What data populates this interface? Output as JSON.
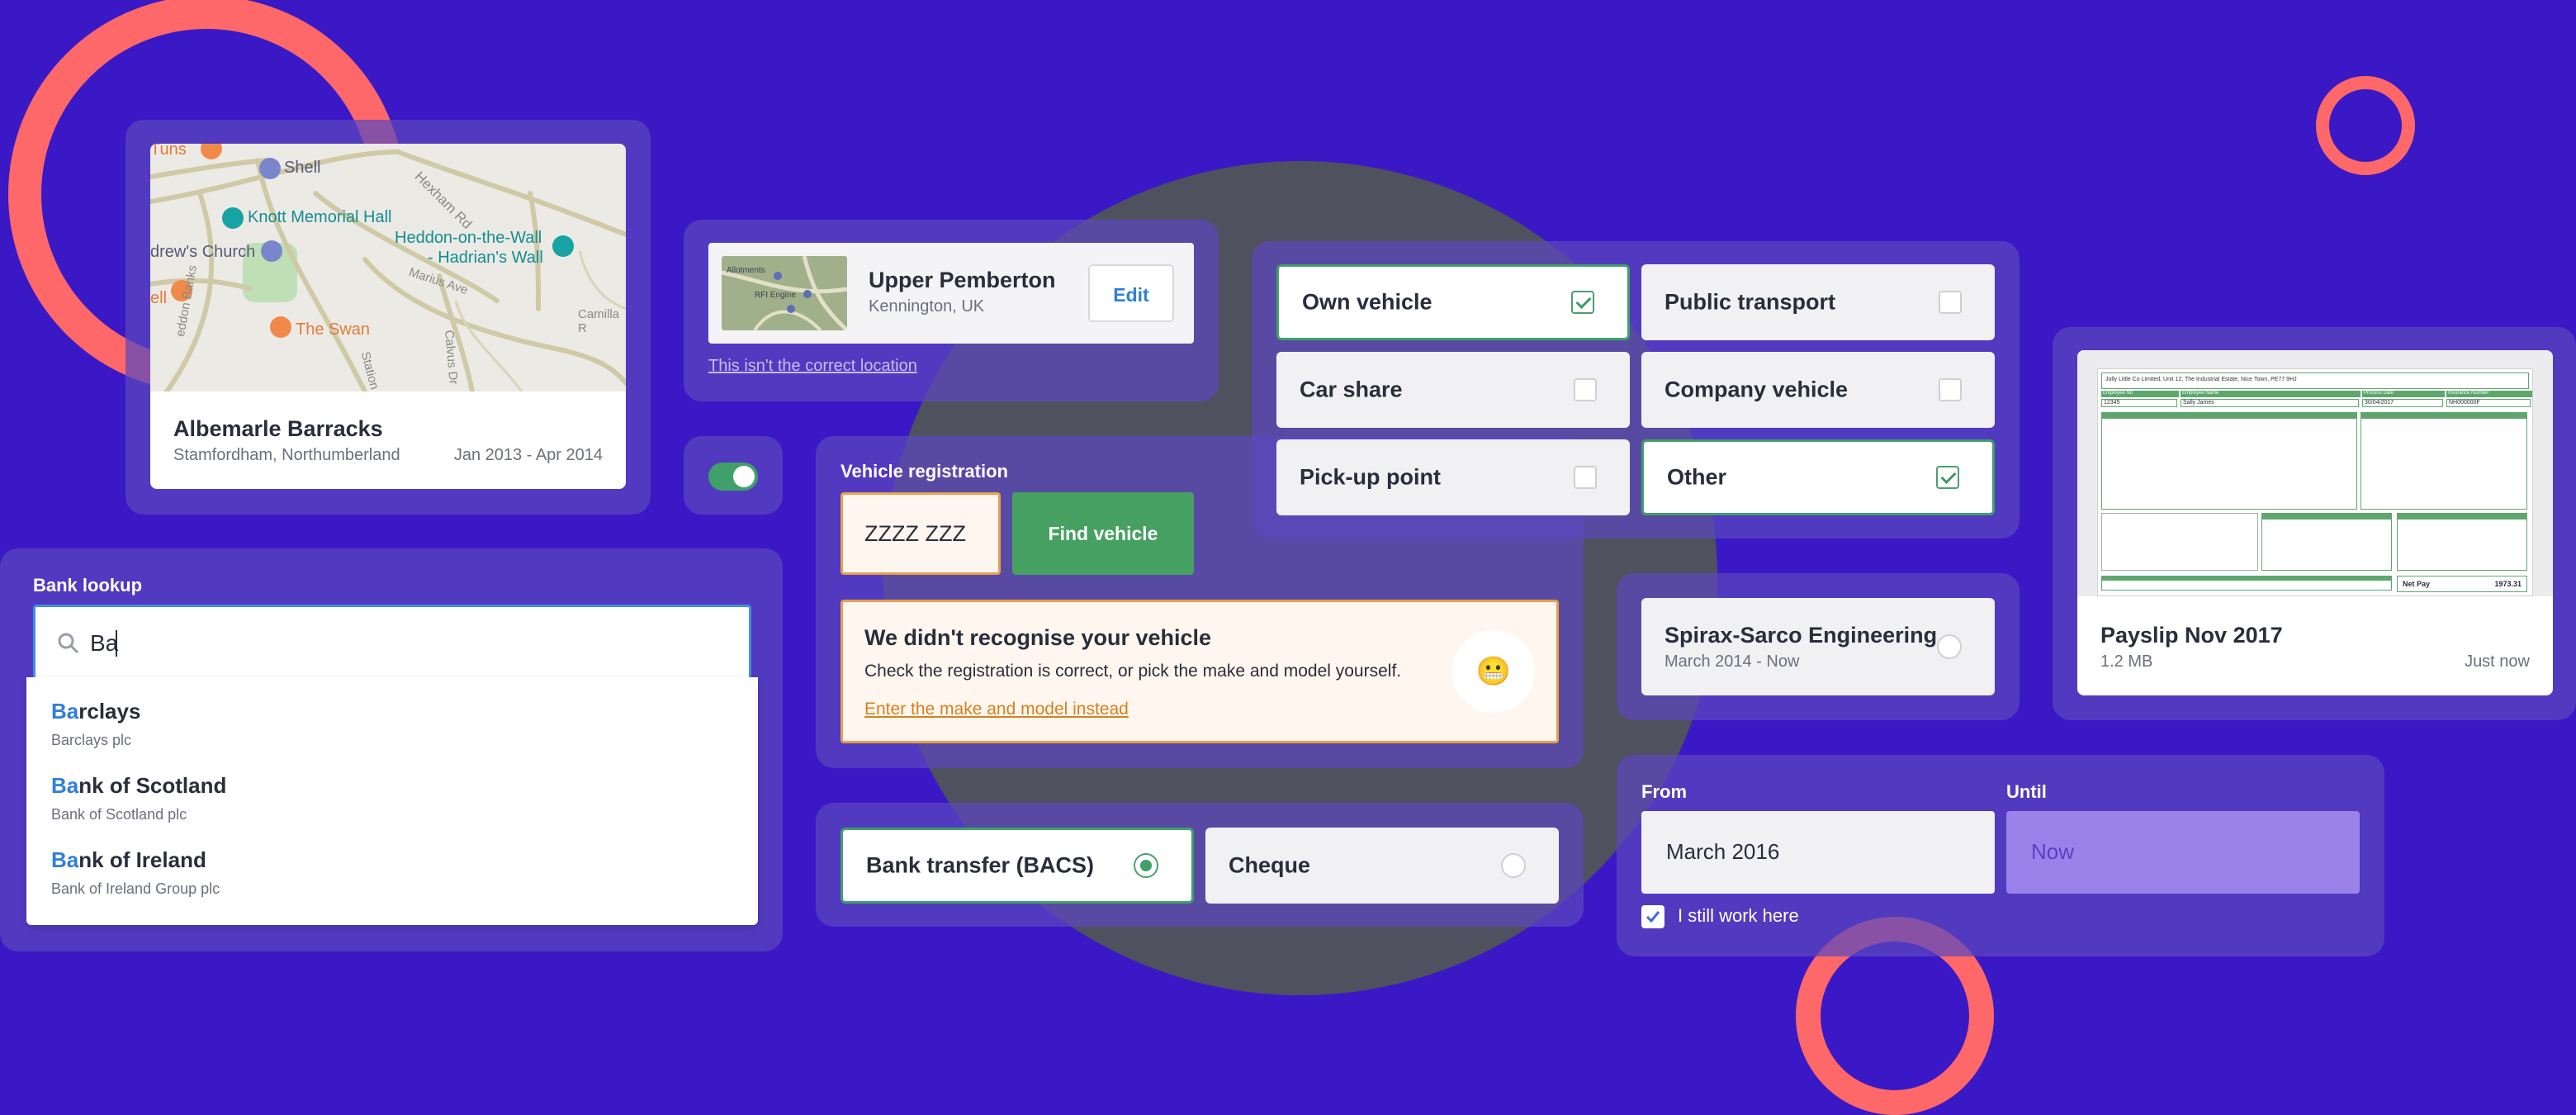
{
  "colors": {
    "background": "#3a18c6",
    "panel": "#5536cf",
    "accent_green": "#46a062",
    "ring_coral": "#ff6868",
    "link_blue": "#2f7fd8",
    "warning_orange": "#e8a04a"
  },
  "location_card": {
    "map": {
      "labels": [
        "Tuns",
        "Shell",
        "Knott Memorial Hall",
        "Hexham Rd",
        "Heddon-on-the-Wall",
        "- Hadrian's Wall",
        "drew's Church",
        "ell",
        "The Swan",
        "Marius Ave",
        "Camilla R",
        "Station",
        "Calvus Dr",
        "eddon Banks"
      ]
    },
    "title": "Albemarle Barracks",
    "subtitle": "Stamfordham, Northumberland",
    "dates": "Jan 2013 - Apr 2014"
  },
  "address_card": {
    "thumb_labels": [
      "Allotments",
      "RFI Engine"
    ],
    "title": "Upper Pemberton",
    "subtitle": "Kennington, UK",
    "edit_label": "Edit",
    "link": "This isn't the correct location"
  },
  "toggle": {
    "state": "on"
  },
  "vehicle": {
    "label": "Vehicle registration",
    "value": "ZZZZ ZZZ",
    "button": "Find vehicle",
    "warning_title": "We didn't recognise your vehicle",
    "warning_body": "Check the registration is correct, or pick the make and model yourself.",
    "warning_link": "Enter the make and model instead",
    "emoji": "😬"
  },
  "transport": {
    "options": [
      {
        "label": "Own vehicle",
        "checked": true
      },
      {
        "label": "Public transport",
        "checked": false
      },
      {
        "label": "Car share",
        "checked": false
      },
      {
        "label": "Company vehicle",
        "checked": false
      },
      {
        "label": "Pick-up point",
        "checked": false
      },
      {
        "label": "Other",
        "checked": true
      }
    ]
  },
  "payslip": {
    "doc": {
      "company": "Jolly Little Co Limited, Unit 12, The Industrial Estate, Nice Town, PE77 9HJ",
      "headers": [
        "Employee No",
        "Employee Name",
        "Process Date",
        "Insurance Number"
      ],
      "values": [
        "12345",
        "Sally James",
        "30/04/2017",
        "NH000000F"
      ],
      "net_pay_label": "Net Pay",
      "net_pay": "1973.31"
    },
    "title": "Payslip Nov 2017",
    "size": "1.2 MB",
    "time": "Just now"
  },
  "bank_lookup": {
    "label": "Bank lookup",
    "query": "Ba",
    "results": [
      {
        "match": "Ba",
        "rest": "rclays",
        "sub": "Barclays plc"
      },
      {
        "match": "Ba",
        "rest": "nk of Scotland",
        "sub": "Bank of Scotland plc"
      },
      {
        "match": "Ba",
        "rest": "nk of Ireland",
        "sub": "Bank of Ireland Group plc"
      }
    ]
  },
  "employer": {
    "title": "Spirax-Sarco Engineering",
    "dates": "March 2014 - Now"
  },
  "payment": {
    "options": [
      {
        "label": "Bank transfer (BACS)",
        "selected": true
      },
      {
        "label": "Cheque",
        "selected": false
      }
    ]
  },
  "dates": {
    "from_label": "From",
    "from_value": "March 2016",
    "until_label": "Until",
    "until_value": "Now",
    "still_label": "I still work here",
    "still_checked": true
  }
}
